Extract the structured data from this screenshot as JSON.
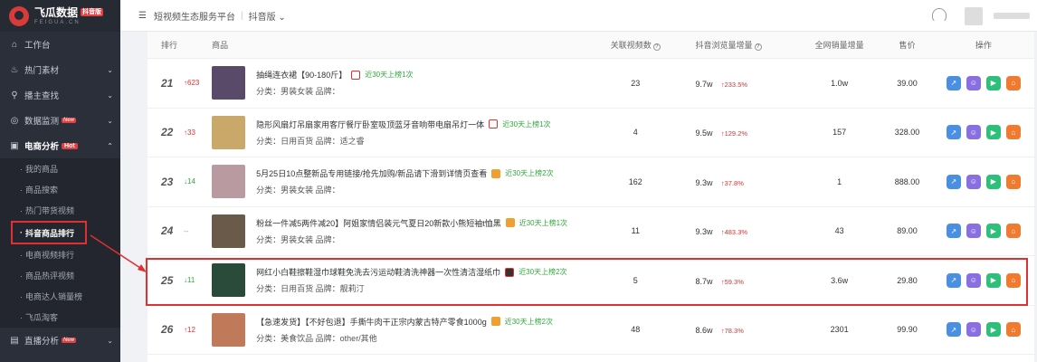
{
  "app": {
    "logo_name": "飞瓜数据",
    "logo_badge": "抖音版",
    "logo_sub": "FEIGUA.CN"
  },
  "topbar": {
    "platform": "短视频生态服务平台",
    "version": "抖音版"
  },
  "sidebar": {
    "items": [
      {
        "label": "工作台",
        "icon": "home-icon"
      },
      {
        "label": "热门素材",
        "icon": "fire-icon"
      },
      {
        "label": "播主查找",
        "icon": "search-icon"
      },
      {
        "label": "数据监测",
        "icon": "monitor-icon",
        "badge": "New"
      },
      {
        "label": "电商分析",
        "icon": "cart-icon",
        "badge": "Hot"
      },
      {
        "label": "直播分析",
        "icon": "live-icon",
        "badge": "New"
      }
    ],
    "sub_items": [
      {
        "label": "我的商品"
      },
      {
        "label": "商品搜索"
      },
      {
        "label": "热门带货视频"
      },
      {
        "label": "抖音商品排行"
      },
      {
        "label": "电商视频排行"
      },
      {
        "label": "商品热评视频"
      },
      {
        "label": "电商达人销量榜"
      },
      {
        "label": "飞瓜淘客"
      }
    ]
  },
  "table": {
    "headers": {
      "rank": "排行",
      "product": "商品",
      "videos": "关联视频数",
      "views": "抖音浏览量增量",
      "sales": "全网销量增量",
      "price": "售价",
      "ops": "操作"
    },
    "rows": [
      {
        "rank": "21",
        "delta": "↑623",
        "dir": "up",
        "title": "抽绳连衣裙【90-180斤】",
        "shop": "red",
        "tag": "近30天上榜1次",
        "meta": "分类：男装女装 品牌：",
        "videos": "23",
        "views": "9.7w",
        "pct": "↑233.5%",
        "sales": "1.0w",
        "price": "39.00",
        "thumb": "#5a4a6a"
      },
      {
        "rank": "22",
        "delta": "↑33",
        "dir": "up",
        "title": "隐形风扇灯吊扇家用客厅餐厅卧室吸顶蓝牙音响带电扇吊灯一体",
        "shop": "red",
        "tag": "近30天上榜1次",
        "meta": "分类：日用百货 品牌：适之睿",
        "videos": "4",
        "views": "9.5w",
        "pct": "↑129.2%",
        "sales": "157",
        "price": "328.00",
        "thumb": "#c9a86a"
      },
      {
        "rank": "23",
        "delta": "↓14",
        "dir": "down",
        "title": "5月25日10点整新品专用链接/抢先加购/新品请下滑到详情页查看",
        "shop": "orange",
        "tag": "近30天上榜2次",
        "meta": "分类：男装女装 品牌：",
        "videos": "162",
        "views": "9.3w",
        "pct": "↑37.8%",
        "sales": "1",
        "price": "888.00",
        "thumb": "#b89aa0"
      },
      {
        "rank": "24",
        "delta": "--",
        "dir": "flat",
        "title": "粉丝一件减5两件减20】阿姐家情侣装元气夏日20新款小熊短袖t恤黑",
        "shop": "orange",
        "tag": "近30天上榜1次",
        "meta": "分类：男装女装 品牌：",
        "videos": "11",
        "views": "9.3w",
        "pct": "↑483.3%",
        "sales": "43",
        "price": "89.00",
        "thumb": "#6a5a4a"
      },
      {
        "rank": "25",
        "delta": "↓11",
        "dir": "down",
        "title": "网红小白鞋擦鞋湿巾球鞋免洗去污运动鞋清洗神器一次性清洁湿纸巾",
        "shop": "dark",
        "tag": "近30天上榜2次",
        "meta": "分类：日用百货 品牌：靓莉汀",
        "videos": "5",
        "views": "8.7w",
        "pct": "↑59.3%",
        "sales": "3.6w",
        "price": "29.80",
        "thumb": "#2a4a3a"
      },
      {
        "rank": "26",
        "delta": "↑12",
        "dir": "up",
        "title": "【急速发货】【不好包退】手撕牛肉干正宗内蒙古特产零食1000g",
        "shop": "orange",
        "tag": "近30天上榜2次",
        "meta": "分类：美食饮品 品牌：other/其他",
        "videos": "48",
        "views": "8.6w",
        "pct": "↑78.3%",
        "sales": "2301",
        "price": "99.90",
        "thumb": "#c07a5a"
      }
    ]
  }
}
